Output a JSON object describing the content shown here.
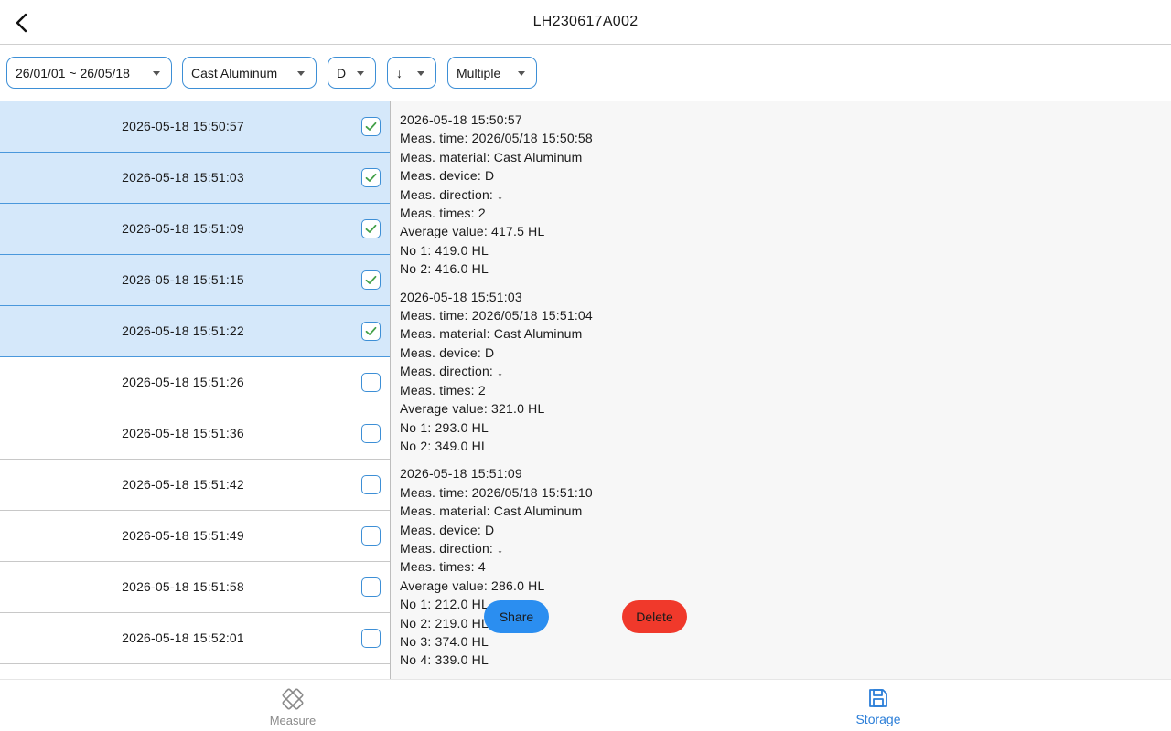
{
  "header": {
    "title": "LH230617A002"
  },
  "filters": {
    "date_range": "26/01/01 ~ 26/05/18",
    "material": "Cast Aluminum",
    "device": "D",
    "direction": "↓",
    "mode": "Multiple"
  },
  "list": [
    {
      "label": "2026-05-18 15:50:57",
      "checked": true
    },
    {
      "label": "2026-05-18 15:51:03",
      "checked": true
    },
    {
      "label": "2026-05-18 15:51:09",
      "checked": true
    },
    {
      "label": "2026-05-18 15:51:15",
      "checked": true
    },
    {
      "label": "2026-05-18 15:51:22",
      "checked": true
    },
    {
      "label": "2026-05-18 15:51:26",
      "checked": false
    },
    {
      "label": "2026-05-18 15:51:36",
      "checked": false
    },
    {
      "label": "2026-05-18 15:51:42",
      "checked": false
    },
    {
      "label": "2026-05-18 15:51:49",
      "checked": false
    },
    {
      "label": "2026-05-18 15:51:58",
      "checked": false
    },
    {
      "label": "2026-05-18 15:52:01",
      "checked": false
    }
  ],
  "records": [
    {
      "lines": [
        "2026-05-18 15:50:57",
        "Meas. time: 2026/05/18 15:50:58",
        "Meas. material: Cast Aluminum",
        "Meas. device: D",
        "Meas. direction: ↓",
        "Meas. times: 2",
        "Average value: 417.5 HL",
        "No 1: 419.0 HL",
        "No 2: 416.0 HL"
      ]
    },
    {
      "lines": [
        "2026-05-18 15:51:03",
        "Meas. time: 2026/05/18 15:51:04",
        "Meas. material: Cast Aluminum",
        "Meas. device: D",
        "Meas. direction: ↓",
        "Meas. times: 2",
        "Average value: 321.0 HL",
        "No 1: 293.0 HL",
        "No 2: 349.0 HL"
      ]
    },
    {
      "lines": [
        "2026-05-18 15:51:09",
        "Meas. time: 2026/05/18 15:51:10",
        "Meas. material: Cast Aluminum",
        "Meas. device: D",
        "Meas. direction: ↓",
        "Meas. times: 4",
        "Average value: 286.0 HL",
        "No 1: 212.0 HL",
        "No 2: 219.0 HL",
        "No 3: 374.0 HL",
        "No 4: 339.0 HL"
      ]
    }
  ],
  "actions": {
    "share": "Share",
    "delete": "Delete"
  },
  "tabs": [
    {
      "label": "Measure",
      "icon": "ruler-icon",
      "active": false
    },
    {
      "label": "Storage",
      "icon": "save-icon",
      "active": true
    }
  ],
  "colors": {
    "accent": "#3d8fd6",
    "selected_row": "#d5e8fa",
    "check": "#43a047",
    "share": "#2b8ef0",
    "delete": "#f0392b",
    "tab_active": "#2b7ed8",
    "tab_inactive": "#8a8a8a"
  }
}
